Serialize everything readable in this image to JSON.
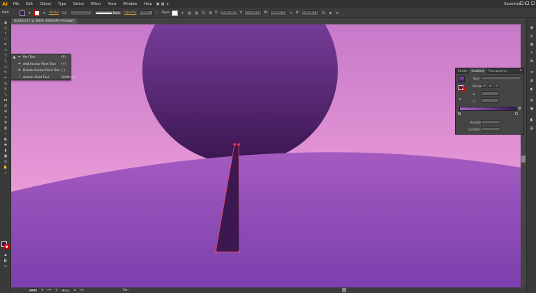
{
  "app": {
    "logo": "Ai"
  },
  "menu": [
    "File",
    "Edit",
    "Object",
    "Type",
    "Select",
    "Effect",
    "View",
    "Window",
    "Help"
  ],
  "workspace": {
    "label": "Essentials"
  },
  "control_bar": {
    "selection_type": "Path",
    "stroke_label": "Stroke",
    "brush_value": "Basic",
    "opacity_label": "Opacity",
    "opacity_value": "100%",
    "style_label": "Style",
    "x_value": "1024,167 px",
    "y_value": "773,667 px",
    "w_value": "29,667 px",
    "h_value": "329,667 px"
  },
  "document": {
    "tab_title": "Untitled-1* @ 300% (RGB/GPU Preview)",
    "close": "×"
  },
  "flyout": {
    "items": [
      {
        "icon": "✒",
        "label": "Pen Tool",
        "shortcut": "(P)"
      },
      {
        "icon": "✒",
        "label": "Add Anchor Point Tool",
        "shortcut": "(+)"
      },
      {
        "icon": "✒",
        "label": "Delete Anchor Point Tool",
        "shortcut": "(-)"
      },
      {
        "icon": "⌃",
        "label": "Anchor Point Tool",
        "shortcut": "(Shift+C)"
      }
    ]
  },
  "gradient_panel": {
    "tabs": [
      "Stroke",
      "Gradient",
      "Transparency"
    ],
    "menu": "≡",
    "type_label": "Type:",
    "stroke_label": "Stroke:",
    "opacity_label": "Opacity:",
    "location_label": "Location:",
    "colors": {
      "start": "#a462c7",
      "end": "#3a1b57"
    }
  },
  "status": {
    "zoom": "300%",
    "page": "1",
    "tool_name": "Pen"
  },
  "colors": {
    "sky_top": "#c679c9",
    "sky_bottom": "#f1a7d8",
    "circle_top": "#8a49b0",
    "circle_bottom": "#3a1550",
    "hill_top": "#a45bc0",
    "hill_bottom": "#7b3fad",
    "trunk": "#3b1850",
    "selection": "#e8455f"
  }
}
